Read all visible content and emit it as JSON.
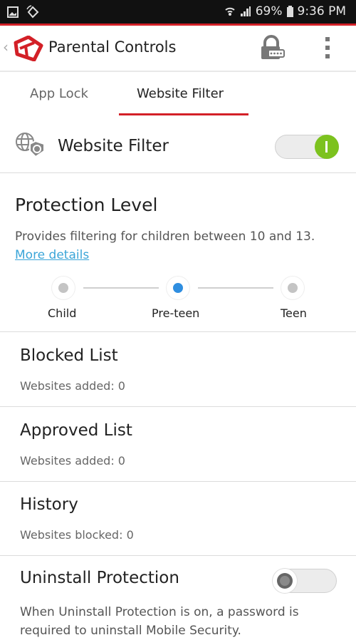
{
  "status_bar": {
    "battery": "69%",
    "time": "9:36 PM",
    "icons": [
      "gallery-icon",
      "rotate-icon",
      "wifi-icon",
      "signal-icon",
      "battery-icon"
    ]
  },
  "app_bar": {
    "title": "Parental Controls",
    "icons": [
      "back-chevron-icon",
      "trend-micro-logo-icon",
      "password-lock-icon",
      "more-vert-icon"
    ]
  },
  "tabs": [
    {
      "label": "App Lock",
      "selected": false
    },
    {
      "label": "Website Filter",
      "selected": true
    }
  ],
  "website_filter": {
    "label": "Website Filter",
    "enabled": true,
    "toggle_color": "#7cc21e"
  },
  "protection_level": {
    "title": "Protection Level",
    "description": "Provides filtering for children between 10 and 13. ",
    "link": "More details",
    "levels": [
      "Child",
      "Pre-teen",
      "Teen"
    ],
    "selected": "Pre-teen"
  },
  "items": [
    {
      "title": "Blocked List",
      "subtitle": "Websites added: 0"
    },
    {
      "title": "Approved List",
      "subtitle": "Websites added: 0"
    },
    {
      "title": "History",
      "subtitle": "Websites blocked: 0"
    }
  ],
  "uninstall_protection": {
    "title": "Uninstall Protection",
    "enabled": false,
    "description": "When Uninstall Protection is on, a password is required to uninstall Mobile Security."
  },
  "colors": {
    "accent": "#d32027",
    "link": "#3aa5d8",
    "selected_dot": "#2f8ee0"
  }
}
